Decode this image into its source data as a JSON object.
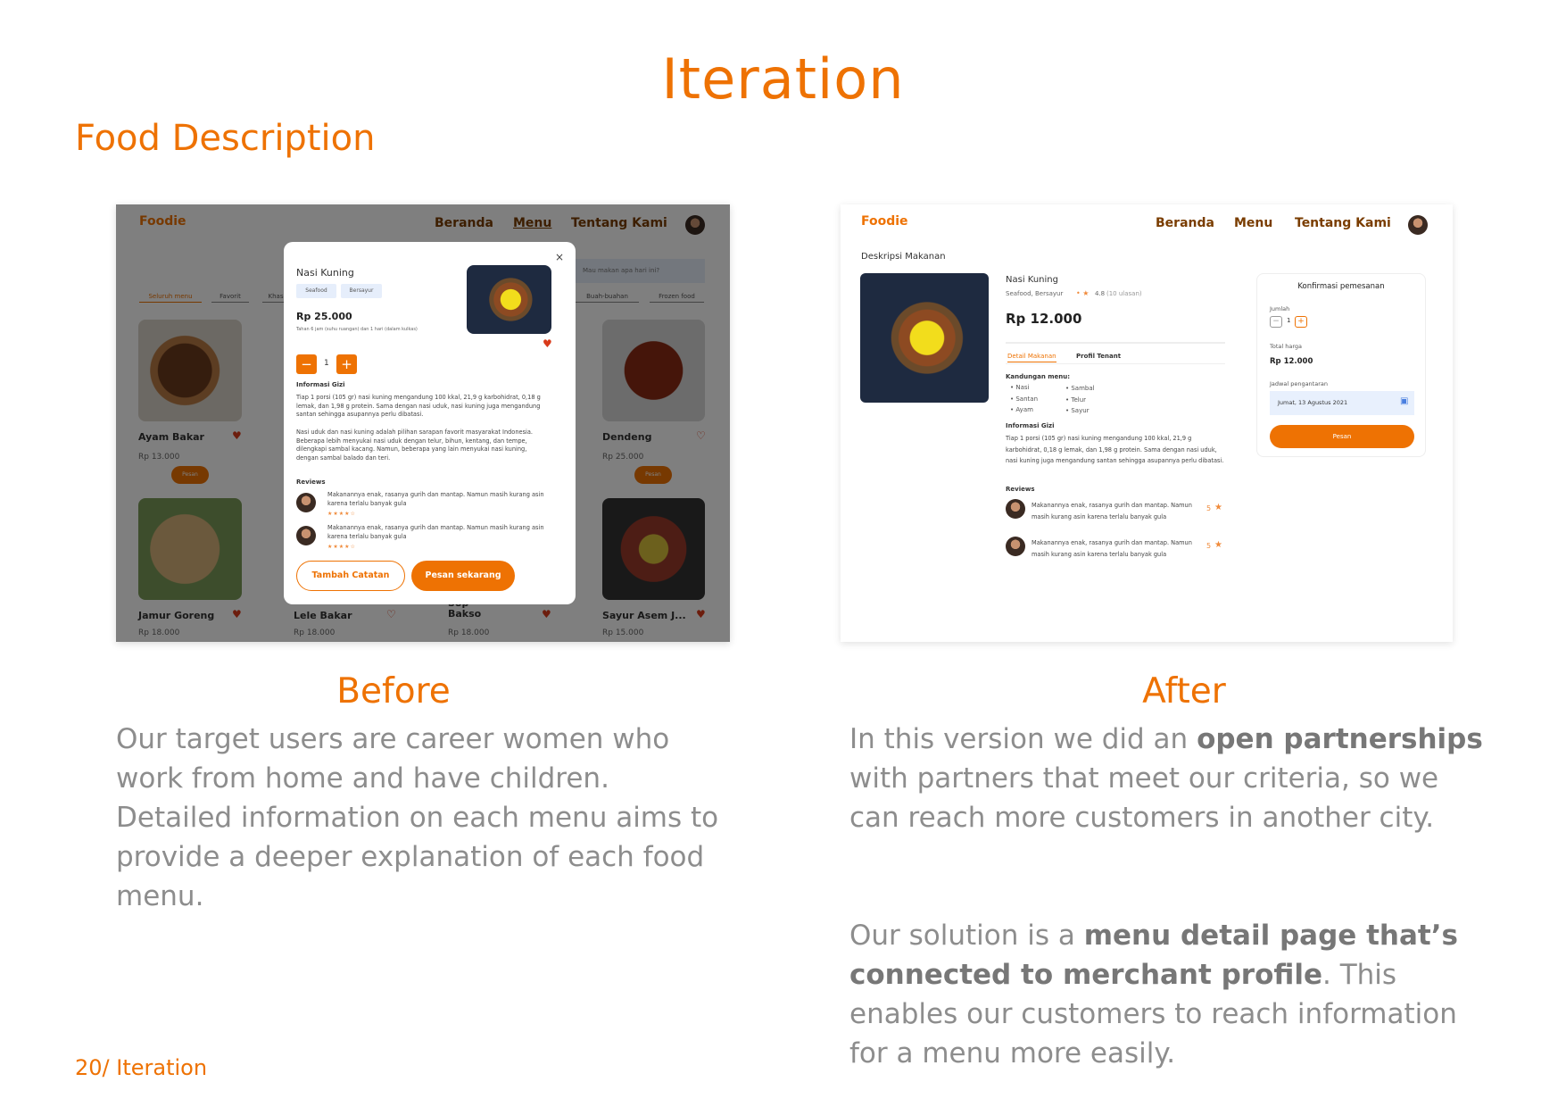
{
  "page": {
    "title": "Iteration",
    "subtitle": "Food Description",
    "footer": "20/ Iteration"
  },
  "colors": {
    "accent": "#ee7203",
    "body_text": "#8d8d8d",
    "nav_text": "#7a3d00"
  },
  "before": {
    "label": "Before",
    "text": "Our target users are career women who work from home and have children. Detailed information on each menu aims to provide a deeper explanation of each food menu.",
    "app": {
      "logo": "Foodie",
      "nav": [
        "Beranda",
        "Menu",
        "Tentang Kami"
      ],
      "search_placeholder": "Mau makan apa hari ini?",
      "tabs": [
        "Seluruh menu",
        "Favorit",
        "Khas",
        "Buah-buahan",
        "Frozen food"
      ],
      "cards": [
        {
          "name": "Ayam Bakar",
          "price": "Rp 13.000",
          "button": "Pesan",
          "favorite": true
        },
        {
          "name": "Dendeng",
          "price": "Rp 25.000",
          "button": "Pesan",
          "favorite": false
        },
        {
          "name": "Jamur Goreng",
          "price": "Rp 18.000",
          "favorite": true
        },
        {
          "name": "Lele Bakar",
          "price": "Rp 18.000",
          "favorite": false
        },
        {
          "name": "Sop Bakso",
          "price": "Rp 18.000",
          "favorite": true
        },
        {
          "name": "Sayur Asem J...",
          "price": "Rp 15.000",
          "favorite": true
        }
      ],
      "modal": {
        "title": "Nasi Kuning",
        "tags": [
          "Seafood",
          "Bersayur"
        ],
        "price": "Rp 25.000",
        "shelf_life": "Tahan 6 jam (suhu ruangan) dan 1 hari (dalam kulkas)",
        "quantity": "1",
        "nutrition_heading": "Informasi Gizi",
        "nutrition_p1": "Tiap 1 porsi (105 gr) nasi kuning mengandung 100 kkal, 21,9 g  karbohidrat, 0,18 g  lemak, dan 1,98 g  protein. Sama dengan nasi uduk, nasi kuning juga mengandung santan sehingga asupannya perlu dibatasi.",
        "nutrition_p2": "Nasi uduk dan nasi kuning adalah pilihan sarapan favorit masyarakat Indonesia. Beberapa lebih menyukai nasi uduk dengan telur, bihun, kentang, dan tempe, dilengkapi sambal kacang. Namun, beberapa yang lain menyukai nasi kuning, dengan sambal balado dan teri.",
        "reviews_heading": "Reviews",
        "reviews": [
          {
            "text": "Makanannya enak, rasanya gurih dan mantap. Namun masih kurang asin karena terlalu banyak gula",
            "rating": 4
          },
          {
            "text": "Makanannya enak, rasanya gurih dan mantap. Namun masih kurang asin karena terlalu banyak gula",
            "rating": 4
          }
        ],
        "secondary_button": "Tambah Catatan",
        "primary_button": "Pesan sekarang"
      }
    }
  },
  "after": {
    "label": "After",
    "p1_pre": "In this version we did an ",
    "p1_bold": "open partnerships",
    "p1_post": " with partners that meet our criteria, so we can reach more customers in another city.",
    "p2_pre": "Our solution is a ",
    "p2_bold": "menu detail page that’s connected to merchant profile",
    "p2_post": ". This enables our customers to reach information for a menu more easily.",
    "app": {
      "logo": "Foodie",
      "nav": [
        "Beranda",
        "Menu",
        "Tentang Kami"
      ],
      "page_heading": "Deskripsi Makanan",
      "food": {
        "name": "Nasi Kuning",
        "categories": "Seafood, Bersayur",
        "rating": "4.8",
        "review_count": "(10 ulasan)",
        "price": "Rp 12.000"
      },
      "tabs": [
        "Detail Makanan",
        "Profil Tenant"
      ],
      "contents_heading": "Kandungan menu:",
      "contents": [
        "Nasi",
        "Santan",
        "Ayam",
        "Sambal",
        "Telur",
        "Sayur"
      ],
      "nutrition_heading": "Informasi Gizi",
      "nutrition": "Tiap 1 porsi (105 gr) nasi kuning mengandung 100 kkal, 21,9 g karbohidrat, 0,18 g  lemak, dan 1,98 g  protein. Sama dengan nasi uduk, nasi kuning juga mengandung santan sehingga asupannya perlu dibatasi.",
      "reviews_heading": "Reviews",
      "reviews": [
        {
          "text": "Makanannya enak, rasanya gurih dan mantap. Namun masih kurang asin karena terlalu banyak gula",
          "rating": "5"
        },
        {
          "text": "Makanannya enak, rasanya gurih dan mantap. Namun masih kurang asin karena terlalu banyak gula",
          "rating": "5"
        }
      ],
      "order": {
        "title": "Konfirmasi pemesanan",
        "qty_label": "Jumlah",
        "quantity": "1",
        "total_label": "Total harga",
        "total": "Rp 12.000",
        "schedule_label": "Jadwal pengantaran",
        "schedule": "Jumat, 13 Agustus 2021",
        "button": "Pesan"
      }
    }
  }
}
